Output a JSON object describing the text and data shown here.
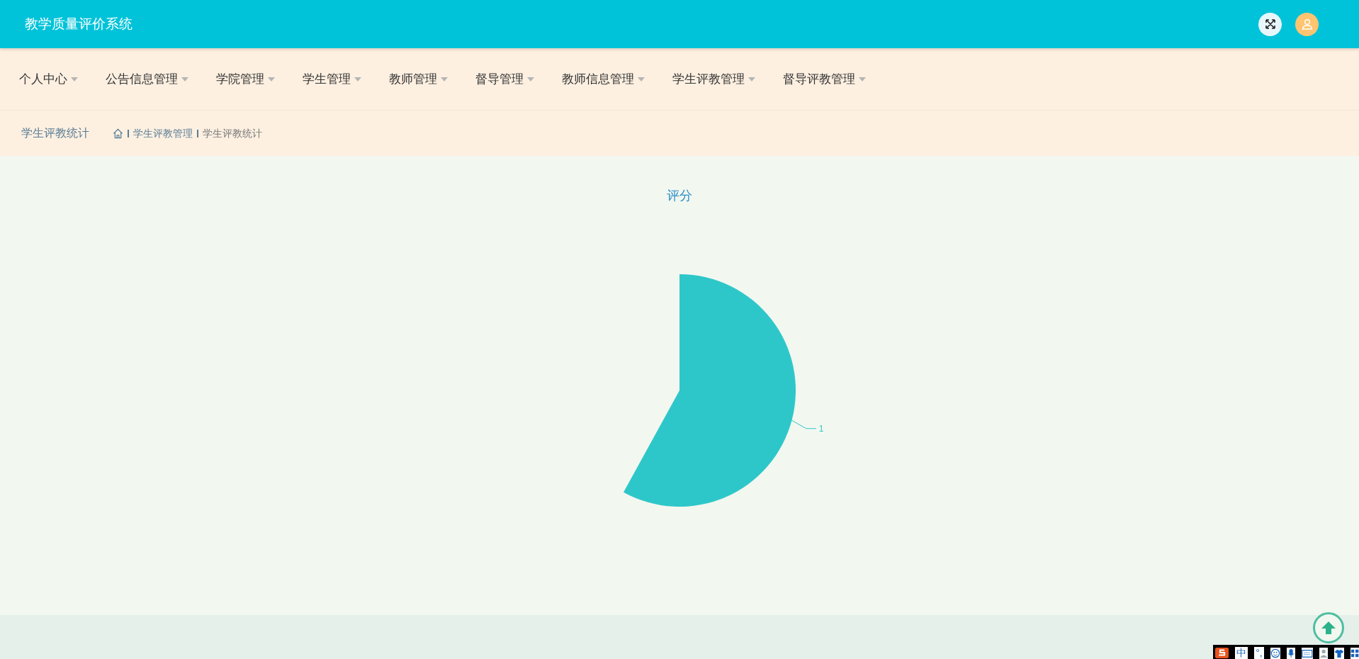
{
  "header": {
    "title": "教学质量评价系统"
  },
  "nav": {
    "items": [
      {
        "label": "个人中心"
      },
      {
        "label": "公告信息管理"
      },
      {
        "label": "学院管理"
      },
      {
        "label": "学生管理"
      },
      {
        "label": "教师管理"
      },
      {
        "label": "督导管理"
      },
      {
        "label": "教师信息管理"
      },
      {
        "label": "学生评教管理"
      },
      {
        "label": "督导评教管理"
      }
    ]
  },
  "breadcrumb": {
    "page_title": "学生评教统计",
    "trail": [
      "学生评教管理",
      "学生评教统计"
    ]
  },
  "chart_data": {
    "type": "pie",
    "title": "评分",
    "categories": [
      "1"
    ],
    "color": "#2ec7c9"
  },
  "ime_toolbar": {
    "mode": "中",
    "punct": "°,"
  }
}
